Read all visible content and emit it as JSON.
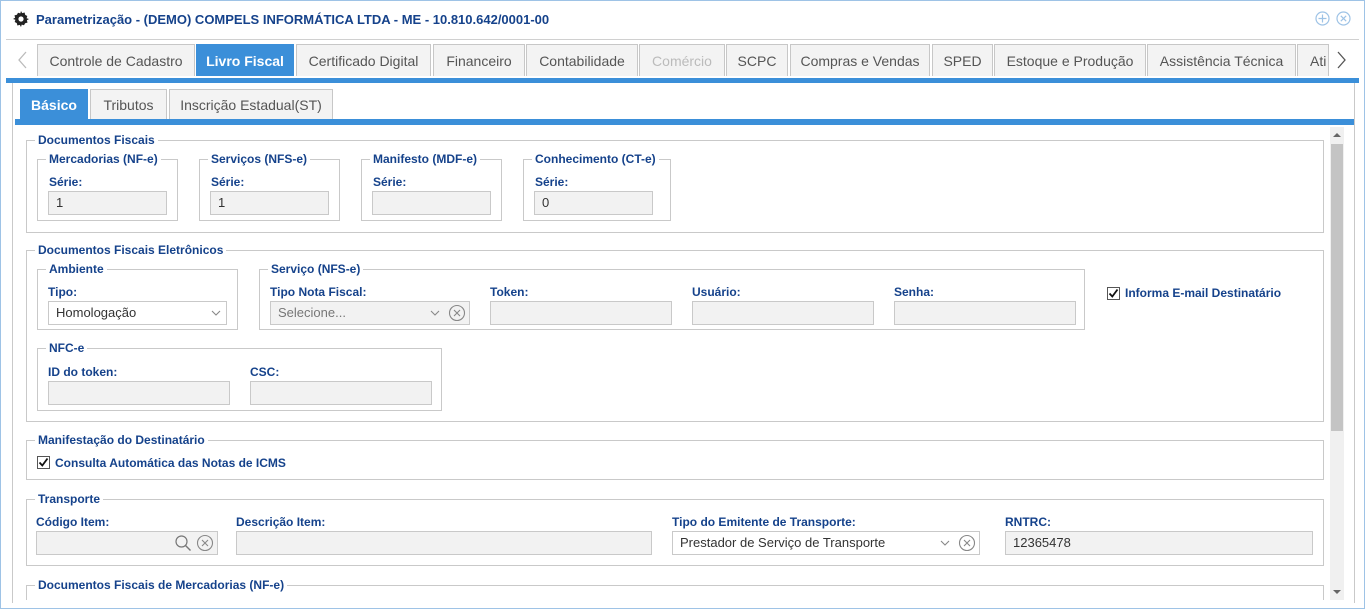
{
  "window": {
    "title": "Parametrização - (DEMO) COMPELS INFORMÁTICA LTDA - ME - 10.810.642/0001-00"
  },
  "tabs": [
    {
      "label": "Controle de Cadastro"
    },
    {
      "label": "Livro Fiscal"
    },
    {
      "label": "Certificado Digital"
    },
    {
      "label": "Financeiro"
    },
    {
      "label": "Contabilidade"
    },
    {
      "label": "Comércio"
    },
    {
      "label": "SCPC"
    },
    {
      "label": "Compras e Vendas"
    },
    {
      "label": "SPED"
    },
    {
      "label": "Estoque e Produção"
    },
    {
      "label": "Assistência Técnica"
    },
    {
      "label": "Ati"
    }
  ],
  "subtabs": [
    {
      "label": "Básico"
    },
    {
      "label": "Tributos"
    },
    {
      "label": "Inscrição Estadual(ST)"
    }
  ],
  "documentos_fiscais": {
    "legend": "Documentos Fiscais",
    "groups": [
      {
        "legend": "Mercadorias (NF-e)",
        "label": "Série:",
        "value": "1"
      },
      {
        "legend": "Serviços (NFS-e)",
        "label": "Série:",
        "value": "1"
      },
      {
        "legend": "Manifesto (MDF-e)",
        "label": "Série:",
        "value": ""
      },
      {
        "legend": "Conhecimento (CT-e)",
        "label": "Série:",
        "value": "0"
      }
    ]
  },
  "eletronicos": {
    "legend": "Documentos Fiscais Eletrônicos",
    "ambiente": {
      "legend": "Ambiente",
      "tipo_label": "Tipo:",
      "tipo_value": "Homologação"
    },
    "servico": {
      "legend": "Serviço (NFS-e)",
      "tipo_label": "Tipo Nota Fiscal:",
      "tipo_placeholder": "Selecione...",
      "token_label": "Token:",
      "usuario_label": "Usuário:",
      "senha_label": "Senha:"
    },
    "informa_email_label": "Informa E-mail Destinatário",
    "nfce": {
      "legend": "NFC-e",
      "id_label": "ID do token:",
      "csc_label": "CSC:"
    }
  },
  "manifestacao": {
    "legend": "Manifestação do Destinatário",
    "consulta_label": "Consulta Automática das Notas de ICMS"
  },
  "transporte": {
    "legend": "Transporte",
    "codigo_label": "Código Item:",
    "descricao_label": "Descrição Item:",
    "tipo_label": "Tipo do Emitente de Transporte:",
    "tipo_value": "Prestador de Serviço de Transporte",
    "rntrc_label": "RNTRC:",
    "rntrc_value": "12365478"
  },
  "mercadorias": {
    "legend": "Documentos Fiscais de Mercadorias (NF-e)"
  },
  "colors": {
    "accent": "#3b8fd9",
    "label": "#15428b"
  }
}
